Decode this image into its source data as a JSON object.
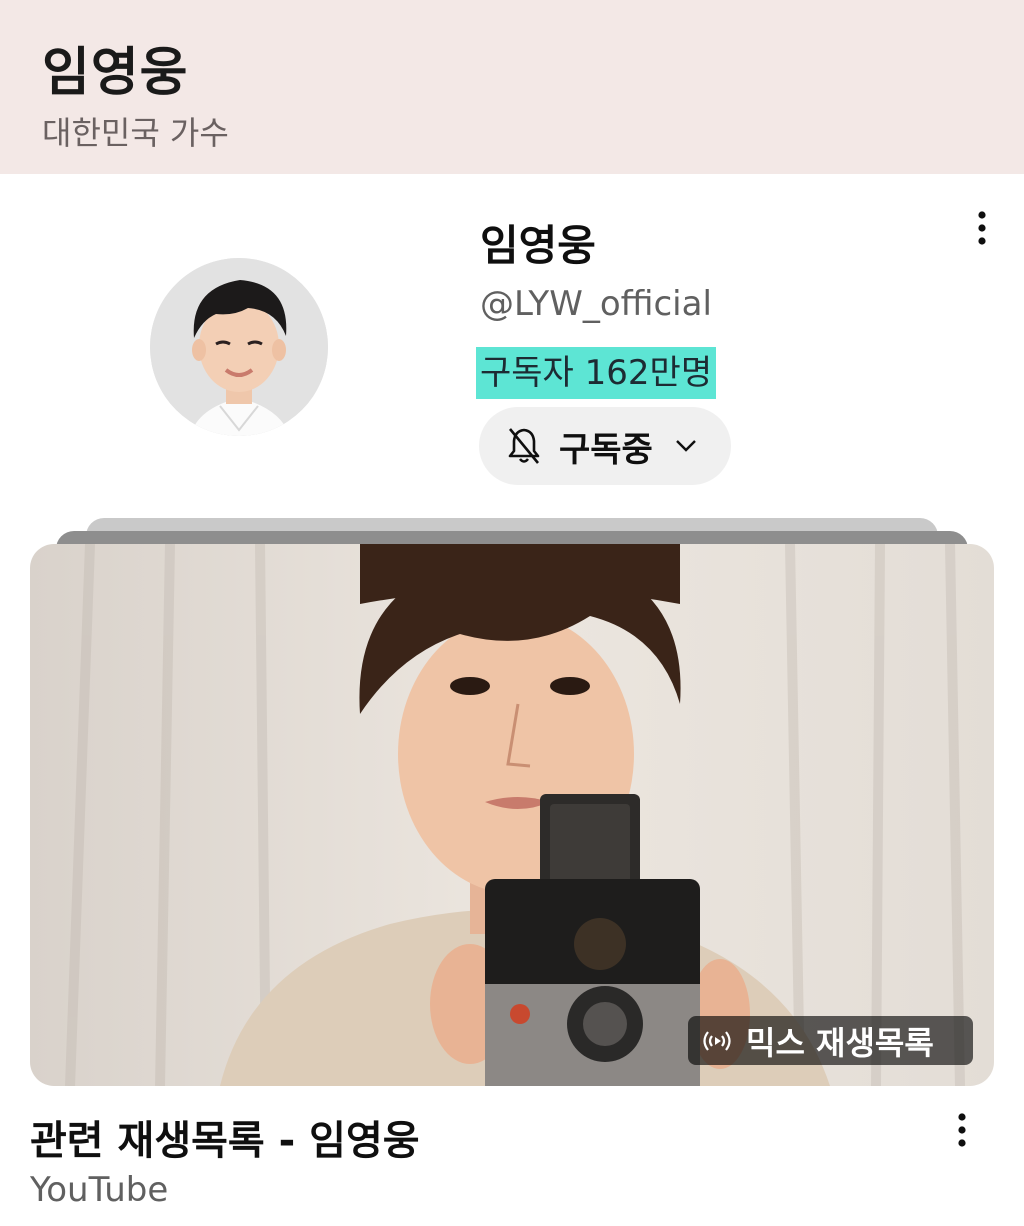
{
  "knowledge_panel": {
    "title": "임영웅",
    "subtitle": "대한민국 가수"
  },
  "channel": {
    "name": "임영웅",
    "handle": "@LYW_official",
    "subscribers": "구독자 162만명",
    "subscribe_button_label": "구독중",
    "bell_icon": "bell-off-icon",
    "highlight_color": "#5de5d4"
  },
  "playlist": {
    "badge_label": "믹스 재생목록",
    "badge_icon": "radio-broadcast-icon",
    "title": "관련 재생목록 - 임영웅",
    "source": "YouTube"
  },
  "icons": {
    "more": "more-vertical-icon",
    "chevron": "chevron-down-icon"
  }
}
